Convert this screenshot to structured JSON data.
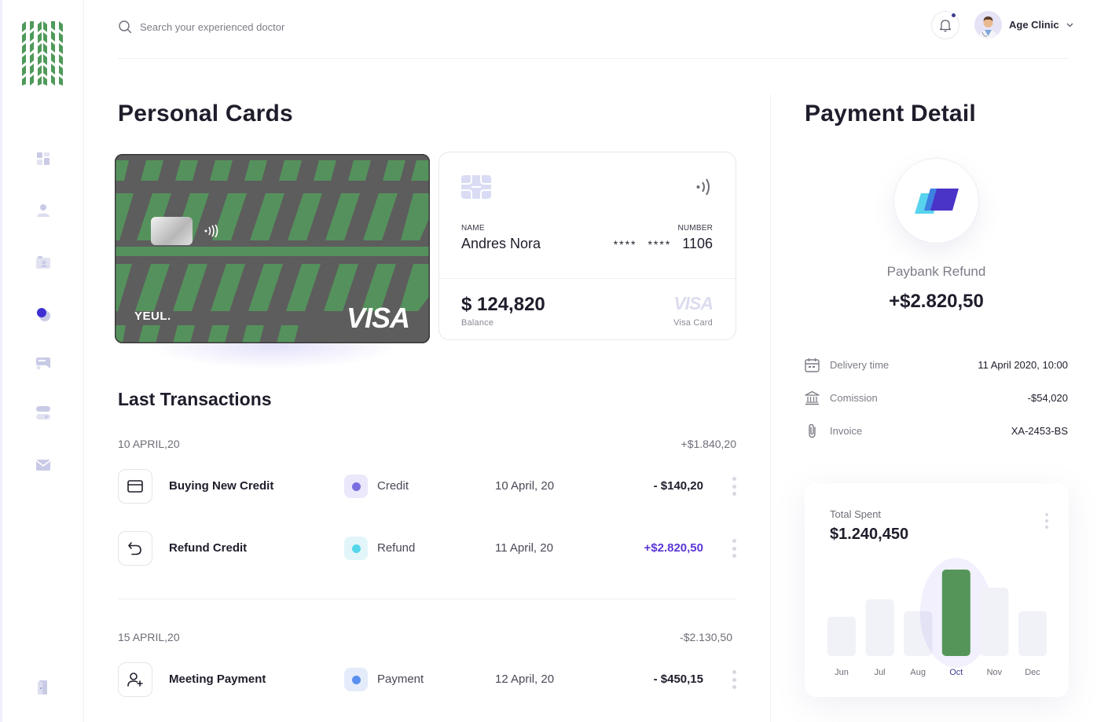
{
  "search": {
    "placeholder": "Search your experienced doctor"
  },
  "user": {
    "name": "Age Clinic"
  },
  "personal_cards": {
    "title": "Personal Cards",
    "card": {
      "brand": "YEUL.",
      "network": "VISA"
    },
    "info": {
      "name_label": "NAME",
      "name": "Andres Nora",
      "number_label": "NUMBER",
      "mask1": "****",
      "mask2": "****",
      "last4": "1106",
      "balance": "$ 124,820",
      "balance_label": "Balance",
      "network": "VISA",
      "network_label": "Visa Card"
    }
  },
  "transactions": {
    "title": "Last Transactions",
    "groups": [
      {
        "date": "10 APRIL,20",
        "total": "+$1.840,20",
        "items": [
          {
            "name": "Buying New Credit",
            "type": "Credit",
            "date": "10 April, 20",
            "amount": "- $140,20"
          },
          {
            "name": "Refund Credit",
            "type": "Refund",
            "date": "11 April, 20",
            "amount": "+$2.820,50"
          }
        ]
      },
      {
        "date": "15 APRIL,20",
        "total": "-$2.130,50",
        "items": [
          {
            "name": "Meeting Payment",
            "type": "Payment",
            "date": "12 April, 20",
            "amount": "- $450,15"
          }
        ]
      }
    ]
  },
  "payment_detail": {
    "title": "Payment Detail",
    "name": "Paybank Refund",
    "amount": "+$2.820,50",
    "rows": [
      {
        "label": "Delivery time",
        "value": "11 April 2020, 10:00",
        "icon": "calendar-icon"
      },
      {
        "label": "Comission",
        "value": "-$54,020",
        "icon": "bank-icon"
      },
      {
        "label": "Invoice",
        "value": "XA-2453-BS",
        "icon": "paperclip-icon"
      }
    ]
  },
  "total_spent": {
    "label": "Total Spent",
    "value": "$1.240,450"
  },
  "chart_data": {
    "type": "bar",
    "categories": [
      "Jun",
      "Jul",
      "Aug",
      "Oct",
      "Nov",
      "Dec"
    ],
    "values": [
      50,
      72,
      57,
      110,
      87,
      57
    ],
    "highlight": "Oct",
    "colors": {
      "bar": "#f1f1f8",
      "highlight": "#559559",
      "highlight_label": "#3f3c8f",
      "label": "#6e6d78"
    }
  },
  "colors": {
    "green": "#559559",
    "accent": "#5a36d6",
    "navy": "#3f3c8f"
  }
}
